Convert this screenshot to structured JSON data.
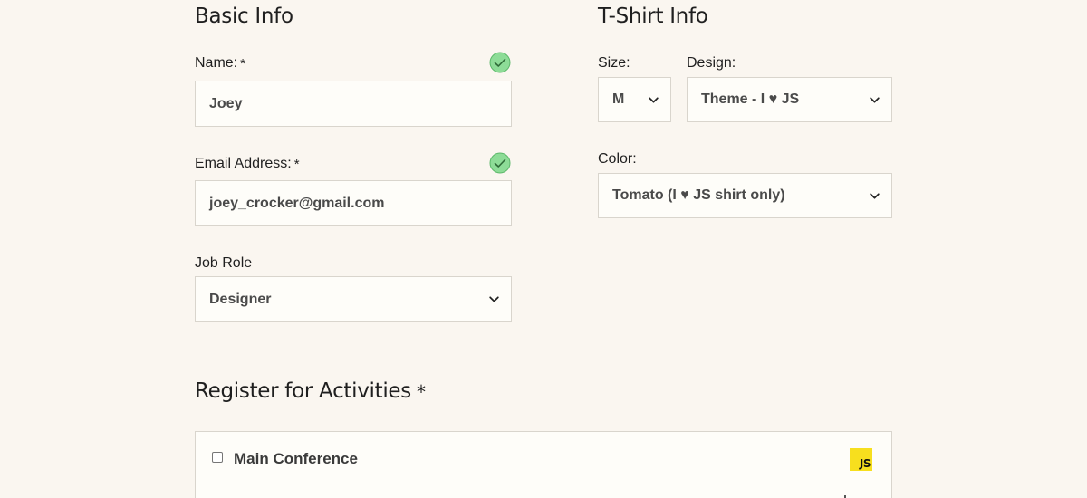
{
  "basic_info": {
    "heading": "Basic Info",
    "name": {
      "label": "Name:",
      "required_mark": "*",
      "value": "Joey",
      "valid_icon": "check-circle-icon"
    },
    "email": {
      "label": "Email Address:",
      "required_mark": "*",
      "value": "joey_crocker@gmail.com",
      "valid_icon": "check-circle-icon"
    },
    "job_role": {
      "label": "Job Role",
      "selected": "Designer"
    }
  },
  "tshirt_info": {
    "heading": "T-Shirt Info",
    "size": {
      "label": "Size:",
      "selected": "M"
    },
    "design": {
      "label": "Design:",
      "selected": "Theme - I ♥ JS"
    },
    "color": {
      "label": "Color:",
      "selected": "Tomato (I ♥ JS shirt only)"
    }
  },
  "activities": {
    "heading": "Register for Activities",
    "required_mark": "*",
    "items": [
      {
        "label": "Main Conference",
        "checked": false,
        "logo_text": "JS"
      }
    ]
  },
  "colors": {
    "background": "#faf6f0",
    "field_background": "#fefdf9",
    "field_border": "#d9d5cd",
    "valid_green": "#8ddc97",
    "js_yellow": "#f7df1e"
  }
}
